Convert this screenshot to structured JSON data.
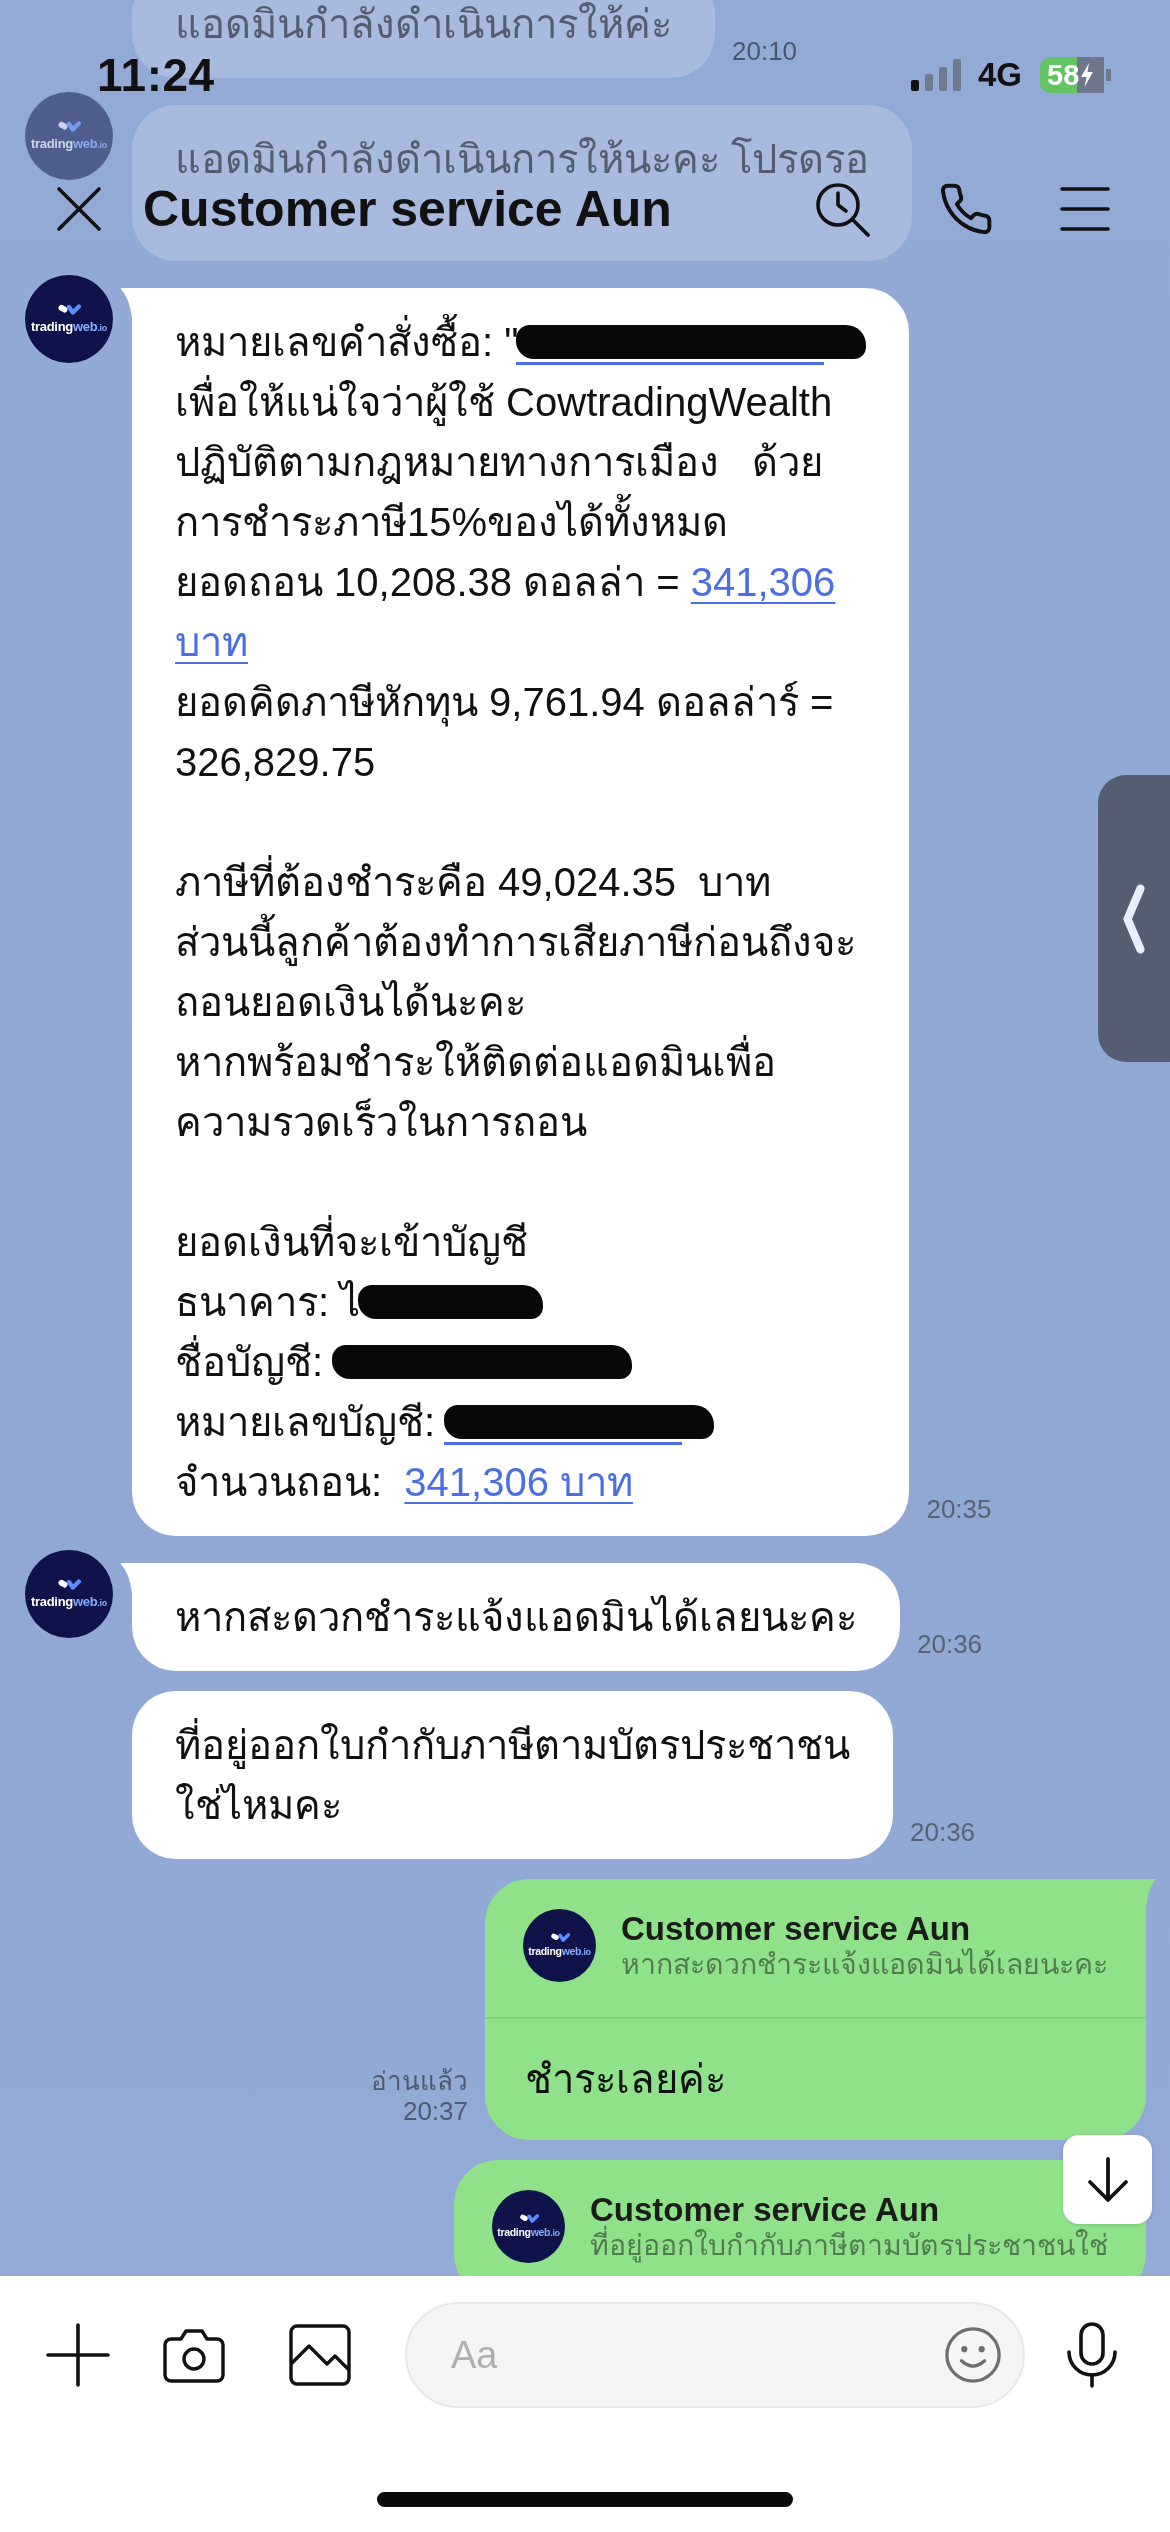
{
  "status_bar": {
    "time": "11:24",
    "network": "4G",
    "battery": "58"
  },
  "header": {
    "title": "Customer service Aun"
  },
  "messages": [
    {
      "kind": "received",
      "tail": false,
      "paragraphs": [
        [
          [
            {
              "kind": "text",
              "text": "แอดมินกำลังดำเนินการให้ค่ะ"
            }
          ]
        ]
      ],
      "time": "20:10"
    },
    {
      "kind": "received",
      "tail": false,
      "avatar": {
        "logo": "trading",
        "logo_accent": "web",
        "logo_suffix": ".io"
      },
      "paragraphs": [
        [
          [
            {
              "kind": "text",
              "text": "แอดมินกำลังดำเนินการให้นะคะ โปรดรอ"
            }
          ]
        ]
      ]
    },
    {
      "kind": "received",
      "tail": true,
      "avatar": {
        "logo": "trading",
        "logo_accent": "web",
        "logo_suffix": ".io"
      },
      "paragraphs": [
        [
          [
            {
              "kind": "text",
              "text": "หมายเลขคำสั่งซื้อ: \""
            },
            {
              "kind": "redacted_link"
            }
          ],
          [
            {
              "kind": "text",
              "text": "เพื่อให้แน่ใจว่าผู้ใช้ CowtradingWealth"
            }
          ],
          [
            {
              "kind": "text",
              "text": "ปฏิบัติตามกฎหมายทางการเมือง   ด้วย"
            }
          ],
          [
            {
              "kind": "text",
              "text": "การชำระภาษี15%ของได้ทั้งหมด"
            }
          ],
          [
            {
              "kind": "text",
              "text": "ยอดถอน 10,208.38 ดอลล่า = "
            },
            {
              "kind": "link",
              "text": "341,306"
            }
          ],
          [
            {
              "kind": "link",
              "text": "บาท"
            }
          ],
          [
            {
              "kind": "text",
              "text": "ยอดคิดภาษีหักทุน 9,761.94 ดอลล่าร์ ="
            }
          ],
          [
            {
              "kind": "text",
              "text": "326,829.75"
            }
          ]
        ],
        [
          [
            {
              "kind": "text",
              "text": "ภาษีที่ต้องชำระคือ 49,024.35  บาท"
            }
          ],
          [
            {
              "kind": "text",
              "text": "ส่วนนี้ลูกค้าต้องทำการเสียภาษีก่อนถึงจะ"
            }
          ],
          [
            {
              "kind": "text",
              "text": "ถอนยอดเงินได้นะคะ"
            }
          ],
          [
            {
              "kind": "text",
              "text": "หากพร้อมชำระให้ติดต่อแอดมินเพื่อ"
            }
          ],
          [
            {
              "kind": "text",
              "text": "ความรวดเร็วในการถอน"
            }
          ]
        ],
        [
          [
            {
              "kind": "text",
              "text": "ยอดเงินที่จะเข้าบัญชี"
            }
          ],
          [
            {
              "kind": "text",
              "text": "ธนาคาร: ไ"
            },
            {
              "kind": "redacted"
            }
          ],
          [
            {
              "kind": "text",
              "text": "ชื่อบัญชี: "
            },
            {
              "kind": "redacted"
            }
          ],
          [
            {
              "kind": "text",
              "text": "หมายเลขบัญชี: "
            },
            {
              "kind": "redacted_link"
            }
          ],
          [
            {
              "kind": "text",
              "text": "จำนวนถอน:  "
            },
            {
              "kind": "link",
              "text": "341,306 บาท"
            }
          ]
        ]
      ],
      "time": "20:35"
    },
    {
      "kind": "received",
      "tail": true,
      "avatar": {
        "logo": "trading",
        "logo_accent": "web",
        "logo_suffix": ".io"
      },
      "paragraphs": [
        [
          [
            {
              "kind": "text",
              "text": "หากสะดวกชำระแจ้งแอดมินได้เลยนะคะ"
            }
          ]
        ]
      ],
      "time": "20:36"
    },
    {
      "kind": "received",
      "tail": false,
      "paragraphs": [
        [
          [
            {
              "kind": "text",
              "text": "ที่อยู่ออกใบกำกับภาษีตามบัตรประชาชน"
            }
          ],
          [
            {
              "kind": "text",
              "text": "ใช่ไหมคะ"
            }
          ]
        ]
      ],
      "time": "20:36"
    },
    {
      "kind": "sent",
      "tail": true,
      "reply": {
        "avatar": {
          "logo": "trading",
          "logo_accent": "web",
          "logo_suffix": ".io"
        },
        "name": "Customer service Aun",
        "text": "หากสะดวกชำระแจ้งแอดมินได้เลยนะคะ"
      },
      "paragraphs": [
        [
          [
            {
              "kind": "text",
              "text": "ชำระเลยค่ะ"
            }
          ]
        ]
      ],
      "read": "อ่านแล้ว",
      "time": "20:37"
    },
    {
      "kind": "sent",
      "tail": false,
      "reply": {
        "avatar": {
          "logo": "trading",
          "logo_accent": "web",
          "logo_suffix": ".io"
        },
        "name": "Customer service Aun",
        "text": "ที่อยู่ออกใบกำกับภาษีตามบัตรประชาชนใช่"
      }
    }
  ],
  "composer": {
    "placeholder": "Aa"
  }
}
